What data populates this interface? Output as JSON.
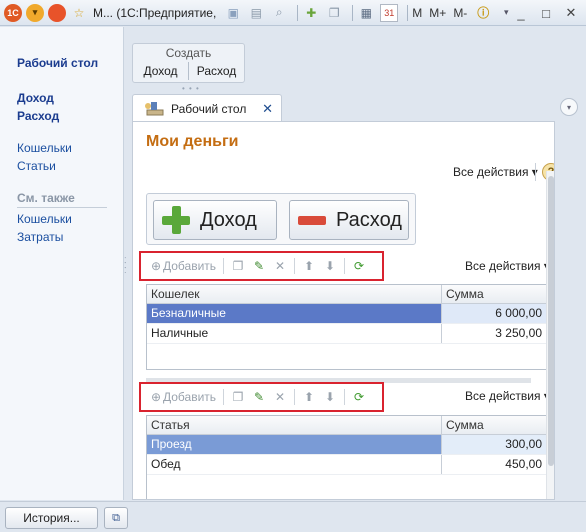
{
  "titlebar": {
    "app_title": "М...  (1С:Предприятие,",
    "m_label": "M",
    "mplus_label": "M+",
    "mminus_label": "M-",
    "calendar_day": "31"
  },
  "sidebar": {
    "title": "Рабочий стол",
    "bold_items": [
      "Доход",
      "Расход"
    ],
    "items": [
      "Кошельки",
      "Статьи"
    ],
    "see_also_header": "См. также",
    "see_also_items": [
      "Кошельки",
      "Затраты"
    ]
  },
  "create_panel": {
    "title": "Создать",
    "items": [
      "Доход",
      "Расход"
    ]
  },
  "tab": {
    "label": "Рабочий стол",
    "close_glyph": "✕"
  },
  "main": {
    "title": "Мои деньги",
    "all_actions": "Все действия ▾",
    "help": "?",
    "income_button": "Доход",
    "expense_button": "Расход"
  },
  "toolbar": {
    "add_label": "Добавить",
    "all_actions": "Все действия ▾"
  },
  "wallets_table": {
    "columns": [
      "Кошелек",
      "Сумма"
    ],
    "rows": [
      {
        "name": "Безналичные",
        "amount": "6 000,00"
      },
      {
        "name": "Наличные",
        "amount": "3 250,00"
      }
    ]
  },
  "articles_table": {
    "columns": [
      "Статья",
      "Сумма"
    ],
    "rows": [
      {
        "name": "Проезд",
        "amount": "300,00"
      },
      {
        "name": "Обед",
        "amount": "450,00"
      }
    ]
  },
  "statusbar": {
    "history_label": "История..."
  },
  "colors": {
    "accent_title": "#c46d12",
    "link": "#1b4fa0",
    "selection": "#5b79c7",
    "highlight_border": "#d9232f",
    "plus_green": "#5aa83a",
    "minus_red": "#d94b3a"
  }
}
